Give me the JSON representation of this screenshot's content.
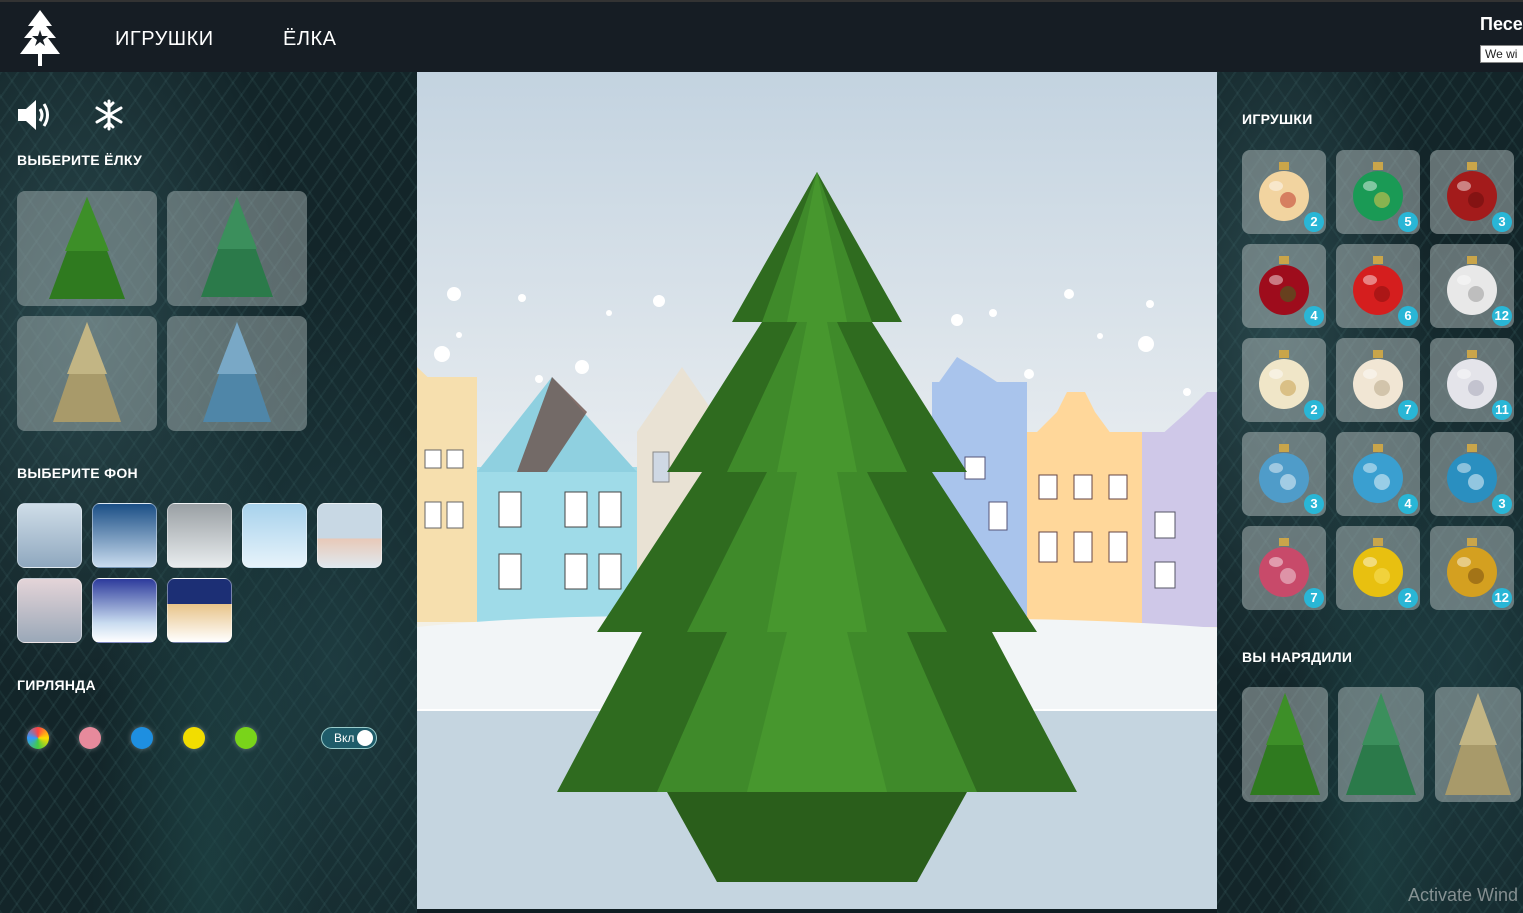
{
  "header": {
    "nav": [
      {
        "label": "ИГРУШКИ"
      },
      {
        "label": "ЁЛКА"
      }
    ],
    "song_title": "Песе",
    "song_select_value": "We wi"
  },
  "left": {
    "icons": {
      "sound": "volume-icon",
      "snow": "snowflake-icon"
    },
    "tree_section_title": "ВЫБЕРИТЕ ЁЛКУ",
    "trees": [
      {
        "name": "tree-1",
        "color": "#2f7a1f"
      },
      {
        "name": "tree-2",
        "color": "#2b7a4a"
      },
      {
        "name": "tree-3",
        "color": "#a89a6a"
      },
      {
        "name": "tree-4",
        "color": "#4f86a8"
      }
    ],
    "bg_section_title": "ВЫБЕРИТЕ ФОН",
    "backgrounds": [
      {
        "name": "bg-1",
        "from": "#cfdde8",
        "to": "#8fa8bf"
      },
      {
        "name": "bg-2",
        "from": "#1b4f86",
        "to": "#c9dcef"
      },
      {
        "name": "bg-3",
        "from": "#9aa0a4",
        "to": "#e8ecee"
      },
      {
        "name": "bg-4",
        "from": "#a7d2ec",
        "to": "#e6f3fb"
      },
      {
        "name": "bg-5",
        "from": "#c8d8e4",
        "to": "#e8c9b8"
      },
      {
        "name": "bg-6",
        "from": "#e4d4d8",
        "to": "#9aa8b8"
      },
      {
        "name": "bg-7",
        "from": "#2d3b9c",
        "to": "#c9dcf0"
      },
      {
        "name": "bg-8",
        "from": "#1c2f75",
        "to": "#e8c48a"
      }
    ],
    "garland_section_title": "ГИРЛЯНДА",
    "garland_colors": [
      {
        "name": "multi",
        "color": "conic-gradient(#f44,#fd0,#4c4,#39f,#f44)"
      },
      {
        "name": "pink",
        "color": "#e78a9c"
      },
      {
        "name": "blue",
        "color": "#1e8fe0"
      },
      {
        "name": "yellow",
        "color": "#f2dd00"
      },
      {
        "name": "green",
        "color": "#79d41a"
      }
    ],
    "garland_toggle_label": "Вкл"
  },
  "right": {
    "toys_title": "ИГРУШКИ",
    "toys": [
      {
        "count": "2",
        "color": "#f2d4a0",
        "accent": "#c0392b"
      },
      {
        "count": "5",
        "color": "#1a9a55",
        "accent": "#e6c84c"
      },
      {
        "count": "3",
        "color": "#a31b1b",
        "accent": "#6b0c0c"
      },
      {
        "count": "4",
        "color": "#9e0c1c",
        "accent": "#3a6b20"
      },
      {
        "count": "6",
        "color": "#d51e1e",
        "accent": "#8a1010"
      },
      {
        "count": "12",
        "color": "#e8e8e8",
        "accent": "#9a9a9a"
      },
      {
        "count": "2",
        "color": "#f0e6c8",
        "accent": "#c8a050"
      },
      {
        "count": "7",
        "color": "#f1e6d4",
        "accent": "#b8a888"
      },
      {
        "count": "11",
        "color": "#e4e4ea",
        "accent": "#a8a8b8"
      },
      {
        "count": "3",
        "color": "#4f9cc9",
        "accent": "#e8f4fa"
      },
      {
        "count": "4",
        "color": "#3a9fd0",
        "accent": "#e8f4fa"
      },
      {
        "count": "3",
        "color": "#2a8fc0",
        "accent": "#e8f4fa"
      },
      {
        "count": "7",
        "color": "#c84a6a",
        "accent": "#f0d0d8"
      },
      {
        "count": "2",
        "color": "#e8c010",
        "accent": "#f8e060"
      },
      {
        "count": "12",
        "color": "#d4a020",
        "accent": "#7a5010"
      }
    ],
    "dressed_title": "ВЫ НАРЯДИЛИ",
    "dressed": [
      {
        "color": "#2f7a1f"
      },
      {
        "color": "#2b7a4a"
      },
      {
        "color": "#a89a6a"
      }
    ]
  },
  "scene": {
    "sky_top": "#c3d3e0",
    "ground": "#ffffff",
    "tree_color": "#2f6b1f"
  },
  "watermark": "Activate Wind"
}
